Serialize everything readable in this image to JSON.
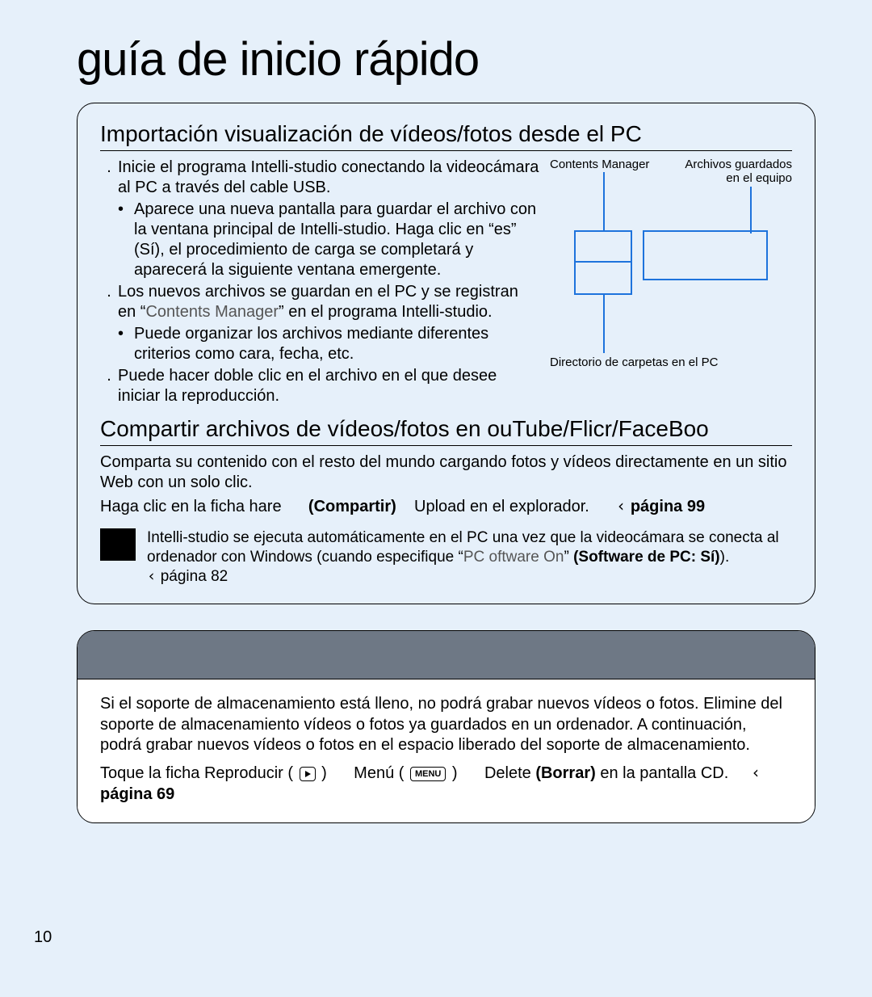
{
  "page_title": "guía de inicio rápido",
  "page_number": "10",
  "section1": {
    "heading": "Importación  visualización de vídeos/fotos desde el PC",
    "step1": "Inicie el programa Intelli-studio conectando la videocámara al PC a través del cable USB.",
    "step1_sub": "Aparece una nueva pantalla para guardar el archivo con la ventana principal de Intelli-studio. Haga clic en “es” (Sí), el procedimiento de carga se completará y aparecerá la siguiente ventana emergente.",
    "step2_a": "Los nuevos archivos se guardan en el PC y se registran en “",
    "step2_cm": "Contents Manager",
    "step2_b": "” en el programa Intelli-studio.",
    "step2_sub": "Puede organizar los archivos mediante diferentes criterios como cara, fecha, etc.",
    "step3": "Puede hacer doble clic en el archivo en el que desee iniciar la reproducción.",
    "diagram": {
      "contents_label": "Contents Manager",
      "saved_label": "Archivos guardados en el equipo",
      "dir_label": "Directorio de carpetas en el PC"
    }
  },
  "section2": {
    "heading": "Compartir archivos de vídeos/fotos en ouTube/Flicr/FaceBoo",
    "intro": "Comparta su contenido con el resto del mundo cargando fotos y vídeos directamente en un sitio Web con un solo clic.",
    "line_a": "Haga clic en la ficha hare",
    "line_b": "(Compartir)",
    "line_c": "Upload en el explorador.",
    "line_ref": "página 99",
    "note_a": "Intelli-studio se ejecuta automáticamente en el PC una vez que la videocámara se conecta al ordenador con Windows (cuando especifique “",
    "note_q": "PC oftware On",
    "note_b": "” ",
    "note_bold": "(Software de PC: Sí)",
    "note_c": ").",
    "note_ref": "página 82"
  },
  "lower": {
    "para": "Si el soporte de almacenamiento está lleno, no podrá grabar nuevos vídeos o fotos. Elimine del soporte de almacenamiento vídeos o fotos ya guardados en un ordenador. A continuación, podrá grabar nuevos vídeos o fotos en el espacio liberado del soporte de almacenamiento.",
    "line_a": "Toque la ficha Reproducir (",
    "line_b": ")",
    "line_c": "Menú (",
    "menu_label": "MENU",
    "line_d": ")",
    "line_e": "Delete ",
    "line_bold": "(Borrar)",
    "line_f": " en la pantalla CD.",
    "line_ref": "página 69"
  }
}
